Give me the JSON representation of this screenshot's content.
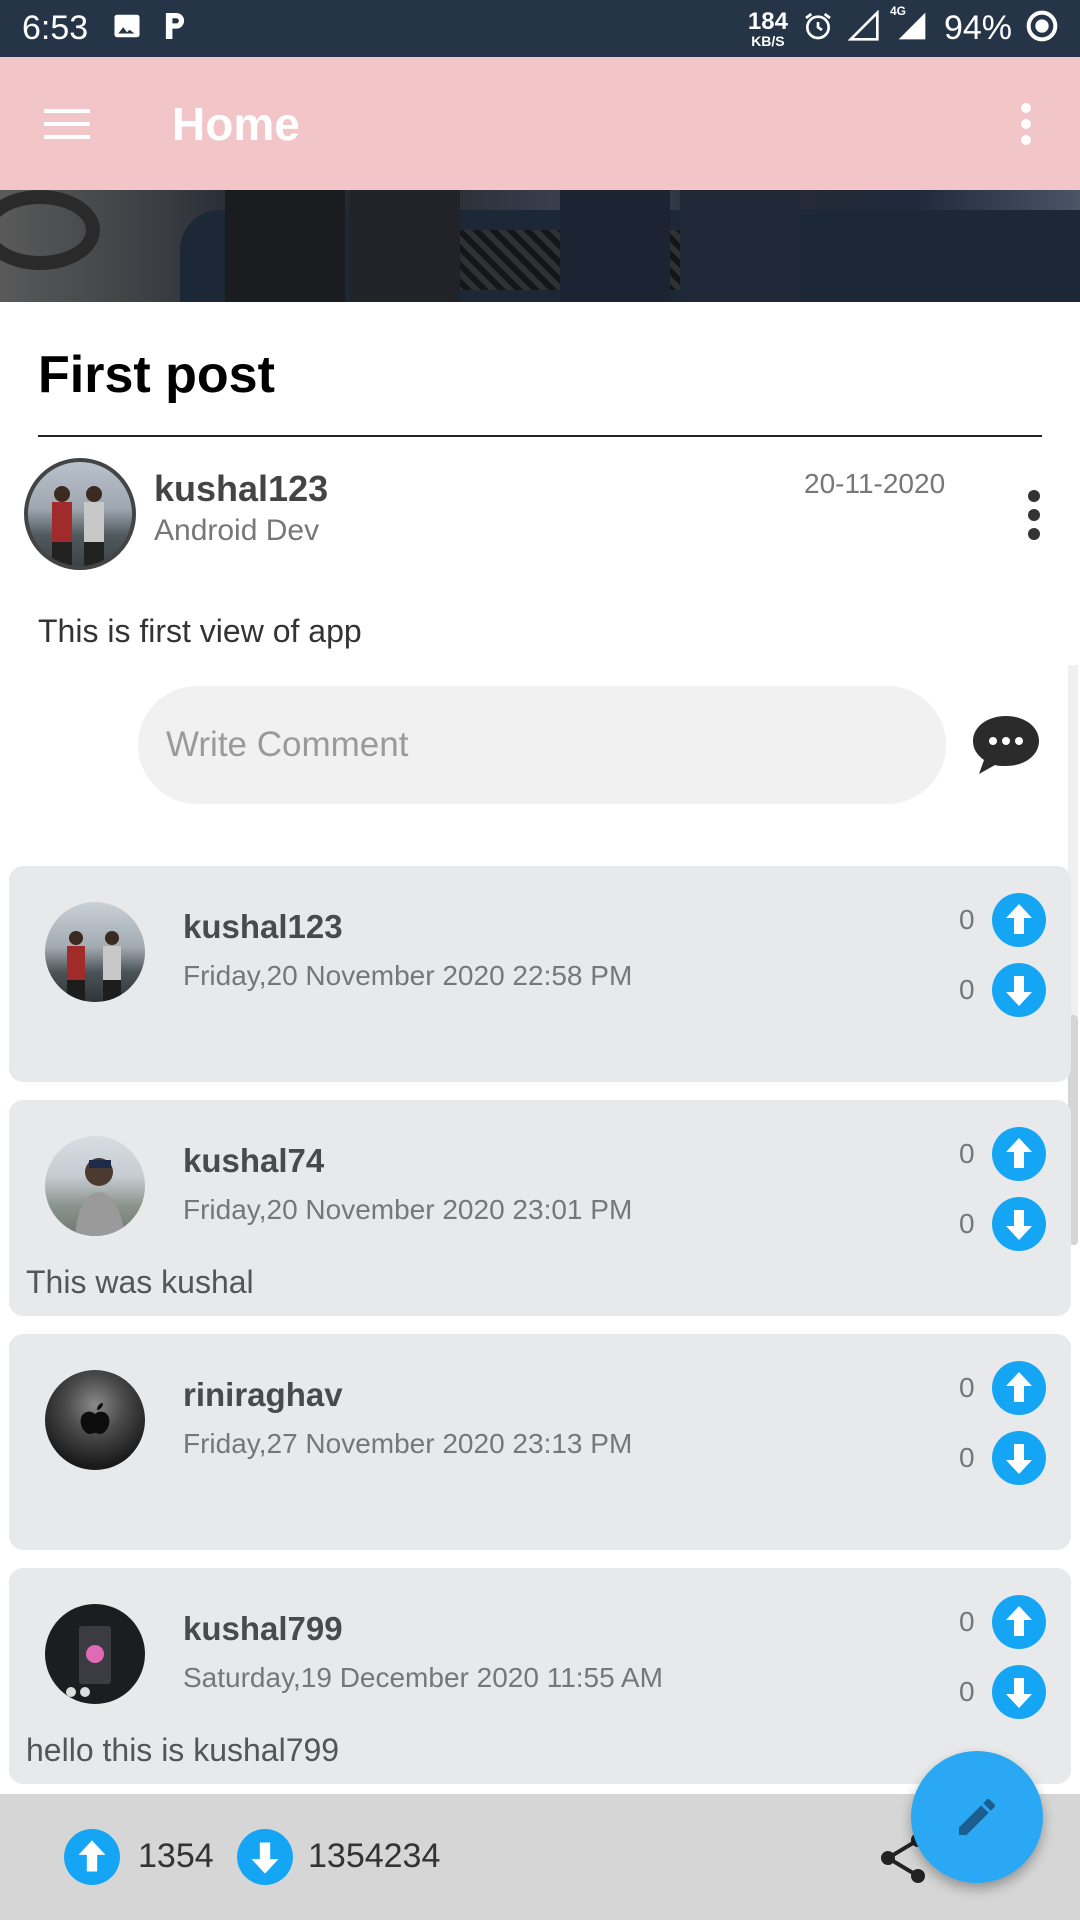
{
  "status_bar": {
    "time": "6:53",
    "speed_value": "184",
    "speed_unit": "KB/S",
    "network_type": "4G",
    "battery": "94%"
  },
  "app_bar": {
    "title": "Home"
  },
  "post": {
    "title": "First post",
    "author_name": "kushal123",
    "author_role": "Android Dev",
    "date": "20-11-2020",
    "body": "This is first view of app",
    "comment_placeholder": "Write Comment"
  },
  "comments": [
    {
      "name": "kushal123",
      "date": "Friday,20 November 2020 22:58 PM",
      "text": "",
      "upvotes": "0",
      "downvotes": "0"
    },
    {
      "name": "kushal74",
      "date": "Friday,20 November 2020 23:01 PM",
      "text": "This was kushal",
      "upvotes": "0",
      "downvotes": "0"
    },
    {
      "name": "riniraghav",
      "date": "Friday,27 November 2020 23:13 PM",
      "text": "",
      "upvotes": "0",
      "downvotes": "0"
    },
    {
      "name": "kushal799",
      "date": "Saturday,19 December 2020 11:55 AM",
      "text": "hello this is kushal799",
      "upvotes": "0",
      "downvotes": "0"
    }
  ],
  "bottom_bar": {
    "upvotes": "1354",
    "downvotes": "1354234"
  },
  "colors": {
    "status_bar": "#253547",
    "app_bar": "#f2c6c8",
    "accent_blue": "#2aa8f3",
    "card": "#e7e9eb",
    "bottom_bar": "#d6d6d6"
  },
  "icons": {
    "menu": "hamburger-icon",
    "overflow": "more-vert-icon",
    "send_comment": "chat-bubble-icon",
    "upvote": "arrow-up-circle-icon",
    "downvote": "arrow-down-circle-icon",
    "share": "share-icon",
    "fab": "pencil-icon"
  }
}
